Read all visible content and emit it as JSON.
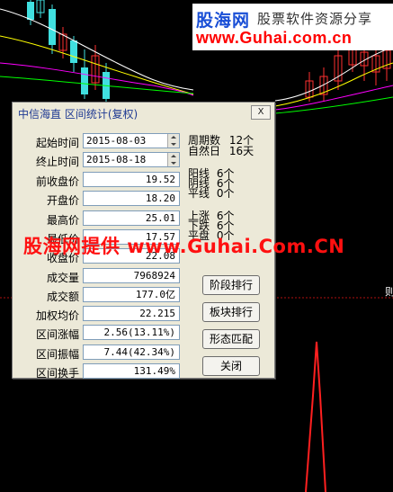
{
  "watermark": {
    "logo": "股海网",
    "slogan": "股票软件资源分享",
    "url": "www.Guhai.com.cn",
    "overlay": "股海网提供 www.Guhai.Com.CN"
  },
  "dialog": {
    "title": "中信海直  区间统计(复权)",
    "close_label": "X",
    "start_label": "起始时间",
    "start_value": "2015-08-03",
    "end_label": "终止时间",
    "end_value": "2015-08-18",
    "fields": [
      {
        "label": "前收盘价",
        "value": "19.52"
      },
      {
        "label": "开盘价",
        "value": "18.20"
      },
      {
        "label": "最高价",
        "value": "25.01"
      },
      {
        "label": "最低价",
        "value": "17.57"
      },
      {
        "label": "收盘价",
        "value": "22.08"
      },
      {
        "label": "成交量",
        "value": "7968924"
      },
      {
        "label": "成交额",
        "value": "177.0亿"
      },
      {
        "label": "加权均价",
        "value": "22.215"
      },
      {
        "label": "区间涨幅",
        "value": "2.56(13.11%)"
      },
      {
        "label": "区间振幅",
        "value": "7.44(42.34%)"
      },
      {
        "label": "区间换手",
        "value": "131.49%"
      }
    ],
    "period": {
      "label": "周期数",
      "value": "12个"
    },
    "natural_days": {
      "label": "自然日",
      "value": "16天"
    },
    "yang": {
      "label": "阳线",
      "value": "6个"
    },
    "yin": {
      "label": "阴线",
      "value": "6个"
    },
    "flat": {
      "label": "平线",
      "value": "0个"
    },
    "up": {
      "label": "上涨",
      "value": "6个"
    },
    "down": {
      "label": "下跌",
      "value": "6个"
    },
    "level": {
      "label": "平盘",
      "value": "0个"
    },
    "buttons": [
      "阶段排行",
      "板块排行",
      "形态匹配",
      "关闭"
    ]
  },
  "chart": {
    "right_label": "则",
    "colors": {
      "up": "#ff3030",
      "down": "#40e0e0",
      "ma1": "#ffffff",
      "ma2": "#ffff00",
      "ma3": "#ff00ff",
      "ma4": "#00ff00",
      "volume": "#ff2020",
      "divider": "#b01010"
    }
  }
}
